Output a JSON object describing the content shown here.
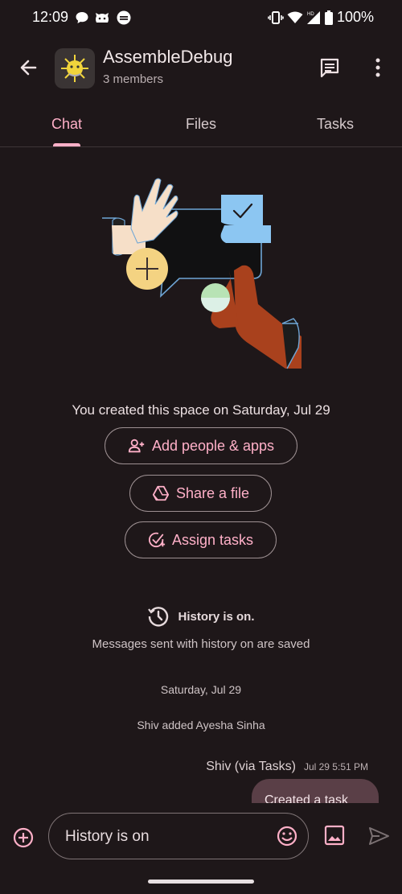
{
  "status_bar": {
    "time": "12:09",
    "battery": "100%",
    "icons": [
      "chat-bubble-icon",
      "android-robot-icon",
      "sync-app-icon",
      "vibrate-icon",
      "wifi-icon",
      "signal-hd-icon",
      "battery-icon"
    ]
  },
  "app_bar": {
    "title": "AssembleDebug",
    "subtitle": "3 members",
    "icons": [
      "back-arrow-icon",
      "space-avatar",
      "threads-icon",
      "more-vert-icon"
    ]
  },
  "tabs": [
    {
      "label": "Chat",
      "active": true
    },
    {
      "label": "Files",
      "active": false
    },
    {
      "label": "Tasks",
      "active": false
    }
  ],
  "welcome": {
    "created_text": "You created this space on Saturday, Jul 29",
    "actions": [
      {
        "label": "Add people & apps",
        "icon": "person-add-icon"
      },
      {
        "label": "Share a file",
        "icon": "drive-icon"
      },
      {
        "label": "Assign tasks",
        "icon": "add-task-icon"
      }
    ]
  },
  "history": {
    "title": "History is on.",
    "subtitle": "Messages sent with history on are saved",
    "icon": "history-icon"
  },
  "messages": {
    "date_separator": "Saturday, Jul 29",
    "system_message": "Shiv added Ayesha Sinha",
    "last": {
      "sender": "Shiv (via Tasks)",
      "time": "Jul 29 5:51 PM",
      "text": "Created a task"
    }
  },
  "composer": {
    "placeholder": "History is on",
    "icons": [
      "add-circle-icon",
      "emoji-icon",
      "image-icon",
      "send-icon"
    ]
  },
  "colors": {
    "background": "#1e1719",
    "accent": "#ffb0c8",
    "bubble": "#5a3f47"
  }
}
